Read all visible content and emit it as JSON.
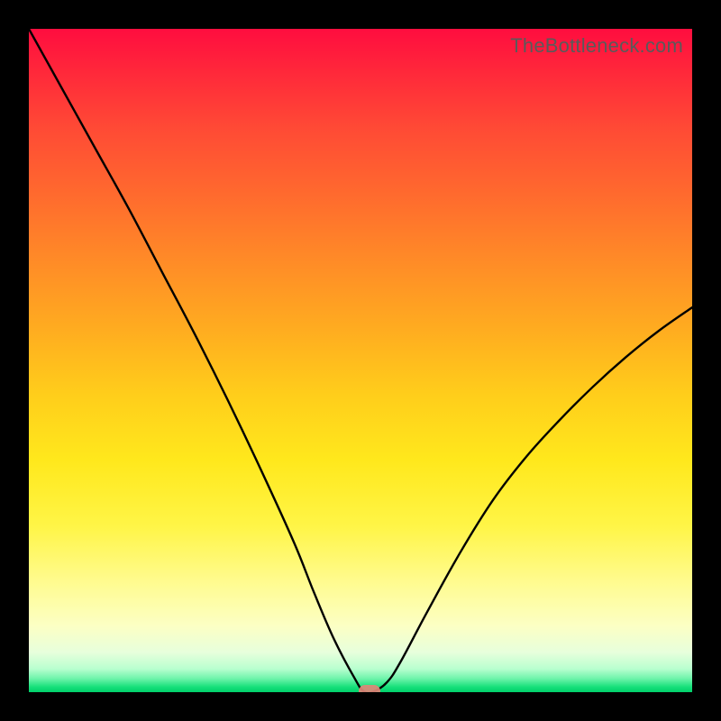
{
  "watermark": "TheBottleneck.com",
  "chart_data": {
    "type": "line",
    "title": "",
    "xlabel": "",
    "ylabel": "",
    "xlim": [
      0,
      100
    ],
    "ylim": [
      0,
      100
    ],
    "grid": false,
    "legend": false,
    "x": [
      0,
      5,
      10,
      15,
      20,
      25,
      30,
      35,
      40,
      43,
      46,
      49,
      50.5,
      52,
      54,
      56,
      60,
      65,
      70,
      75,
      80,
      85,
      90,
      95,
      100
    ],
    "y": [
      100,
      91,
      82,
      73,
      63.5,
      54,
      44,
      33.5,
      22.5,
      15,
      8,
      2.3,
      0.1,
      0.1,
      1.5,
      4.5,
      12,
      21,
      29,
      35.5,
      41,
      46,
      50.5,
      54.5,
      58
    ],
    "marker": {
      "x": 51.3,
      "y": 0.1,
      "color": "#e08778"
    },
    "background_gradient_stops": [
      {
        "pct": 0,
        "color": "#ff0d3f"
      },
      {
        "pct": 50,
        "color": "#ffcd1b"
      },
      {
        "pct": 83,
        "color": "#fffb8c"
      },
      {
        "pct": 100,
        "color": "#00d06a"
      }
    ]
  },
  "colors": {
    "curve": "#000000",
    "frame": "#000000",
    "watermark": "#5a5a5a",
    "marker": "#e08778"
  }
}
